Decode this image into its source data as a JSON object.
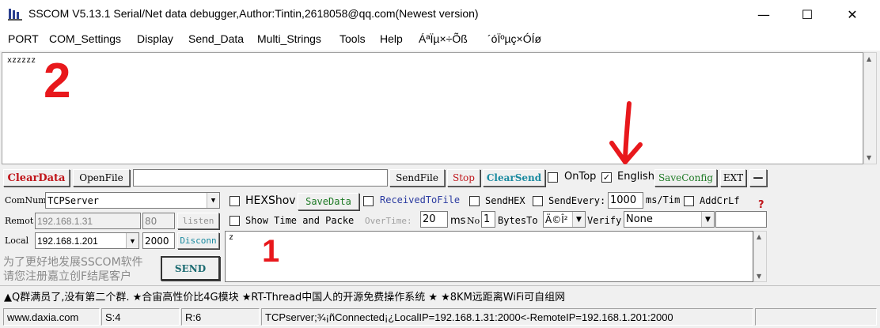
{
  "window": {
    "title": "SSCOM V5.13.1 Serial/Net data debugger,Author:Tintin,2618058@qq.com(Newest version)",
    "minimize": "—",
    "maximize": "☐",
    "close": "✕"
  },
  "menu": [
    "PORT",
    "COM_Settings",
    "Display",
    "Send_Data",
    "Multi_Strings",
    "Tools",
    "Help",
    "ÁªÏµ×÷Õß",
    "´óÏºµç×ÓÍø"
  ],
  "receive": {
    "text": "xzzzzz"
  },
  "toolbar": {
    "clear_data": "ClearData",
    "open_file": "OpenFile",
    "file_path": "",
    "send_file": "SendFile",
    "stop": "Stop",
    "clear_send": "ClearSend",
    "on_top": "OnTop",
    "english": "English",
    "save_config": "SaveConfig",
    "ext": "EXT",
    "collapse": "—"
  },
  "left": {
    "com_num_label": "ComNum",
    "com_num_value": "TCPServer",
    "remote_label": "Remot",
    "remote_ip": "192.168.1.31",
    "remote_port": "80",
    "listen": "listen",
    "local_label": "Local",
    "local_ip": "192.168.1.201",
    "local_port": "2000",
    "disconnect": "Disconn",
    "promo": "为了更好地发展SSCOM软件\n请您注册嘉立创F结尾客户",
    "send": "SEND"
  },
  "options": {
    "hex_show": "HEXShov",
    "save_data": "SaveData",
    "received_to_file": "ReceivedToFile",
    "send_hex": "SendHEX",
    "send_every": "SendEvery:",
    "interval": "1000",
    "interval_unit": "ms/Tim",
    "add_crlf": "AddCrLf",
    "help_mark": "?",
    "show_time": "Show Time and Packe",
    "overtime_label": "OverTime:",
    "overtime_value": "20",
    "ms": "ms",
    "no_label": "No",
    "no_value": "1",
    "bytes_to": "BytesTo",
    "bytes_combo": "Ä©Î²",
    "verify_label": "Verify",
    "verify_value": "None"
  },
  "send_box": {
    "text": "z"
  },
  "ticker": "▲Q群满员了,没有第二个群. ★合宙高性价比4G模块 ★RT-Thread中国人的开源免费操作系统 ★ ★8KM远距离WiFi可自组网",
  "status": {
    "website": "www.daxia.com",
    "sent": "S:4",
    "received": "R:6",
    "connection": "TCPserver;¾¡ñConnected¡¿LocalIP=192.168.1.31:2000<-RemoteIP=192.168.1.201:2000"
  },
  "annotations": [
    "2",
    "1"
  ]
}
